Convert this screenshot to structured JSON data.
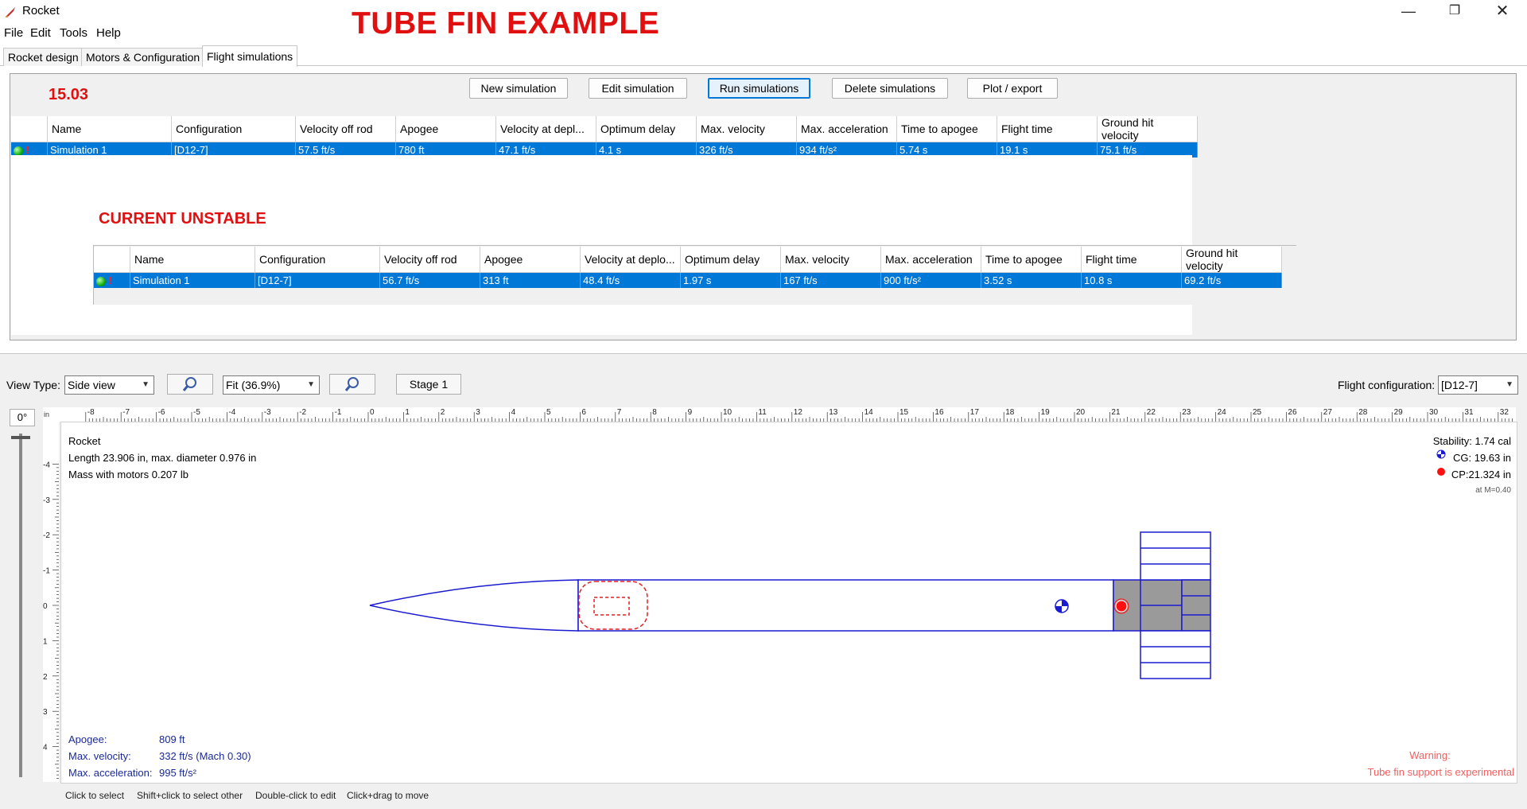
{
  "app": {
    "title": "Rocket",
    "banner": "TUBE FIN EXAMPLE",
    "window_controls": [
      "minimize-icon",
      "restore-icon",
      "close-icon"
    ]
  },
  "menu": [
    "File",
    "Edit",
    "Tools",
    "Help"
  ],
  "tabs": [
    {
      "label": "Rocket design",
      "active": false
    },
    {
      "label": "Motors & Configuration",
      "active": false
    },
    {
      "label": "Flight simulations",
      "active": true
    }
  ],
  "toolbar": {
    "new": "New simulation",
    "edit": "Edit simulation",
    "run": "Run simulations",
    "delete": "Delete simulations",
    "plot": "Plot / export"
  },
  "annotations": {
    "stability_note": "15.03",
    "current_unstable": "CURRENT UNSTABLE"
  },
  "sim_columns": [
    "Name",
    "Configuration",
    "Velocity off rod",
    "Apogee",
    "Velocity at depl...",
    "Optimum delay",
    "Max. velocity",
    "Max. acceleration",
    "Time to apogee",
    "Flight time",
    "Ground hit velocity"
  ],
  "sim_columns_b": [
    "Name",
    "Configuration",
    "Velocity off rod",
    "Apogee",
    "Velocity at deplo...",
    "Optimum delay",
    "Max. velocity",
    "Max. acceleration",
    "Time to apogee",
    "Flight time",
    "Ground hit velocity"
  ],
  "sim_table_a": [
    {
      "name": "Simulation 1",
      "configuration": "[D12-7]",
      "velocity_off_rod": "57.5 ft/s",
      "apogee": "780 ft",
      "velocity_at_deployment": "47.1 ft/s",
      "optimum_delay": "4.1 s",
      "max_velocity": "326 ft/s",
      "max_acceleration": "934 ft/s²",
      "time_to_apogee": "5.74 s",
      "flight_time": "19.1 s",
      "ground_hit_velocity": "75.1 ft/s"
    }
  ],
  "sim_table_b": [
    {
      "name": "Simulation 1",
      "configuration": "[D12-7]",
      "velocity_off_rod": "56.7 ft/s",
      "apogee": "313 ft",
      "velocity_at_deployment": "48.4 ft/s",
      "optimum_delay": "1.97 s",
      "max_velocity": "167 ft/s",
      "max_acceleration": "900 ft/s²",
      "time_to_apogee": "3.52 s",
      "flight_time": "10.8 s",
      "ground_hit_velocity": "69.2 ft/s"
    }
  ],
  "view": {
    "view_type_label": "View Type:",
    "view_type_value": "Side view",
    "zoom_value": "Fit (36.9%)",
    "stage_label": "Stage 1",
    "flight_config_label": "Flight configuration:",
    "flight_config_value": "[D12-7]",
    "angle": "0°",
    "ruler_unit": "in"
  },
  "rocket_info": {
    "name": "Rocket",
    "length": "Length 23.906 in, max. diameter 0.976 in",
    "mass": "Mass with motors 0.207 lb"
  },
  "stability": {
    "stability": "Stability:  1.74 cal",
    "cg": "CG:  19.63 in",
    "cp": "CP:21.324 in",
    "mach": "at M=0.40"
  },
  "flight_summary": {
    "apogee_label": "Apogee:",
    "apogee_value": "809 ft",
    "max_velocity_label": "Max. velocity:",
    "max_velocity_value": "332 ft/s  (Mach 0.30)",
    "max_accel_label": "Max. acceleration:",
    "max_accel_value": "995 ft/s²"
  },
  "warning": {
    "title": "Warning:",
    "text": "Tube fin support is experimental"
  },
  "status_hints": [
    "Click to select",
    "Shift+click to select other",
    "Double-click to edit",
    "Click+drag to move"
  ],
  "colors": {
    "selection": "#0078d7",
    "annotation_red": "#e01010",
    "rocket_outline": "#1a1ad0",
    "warning_text": "#f06060"
  }
}
